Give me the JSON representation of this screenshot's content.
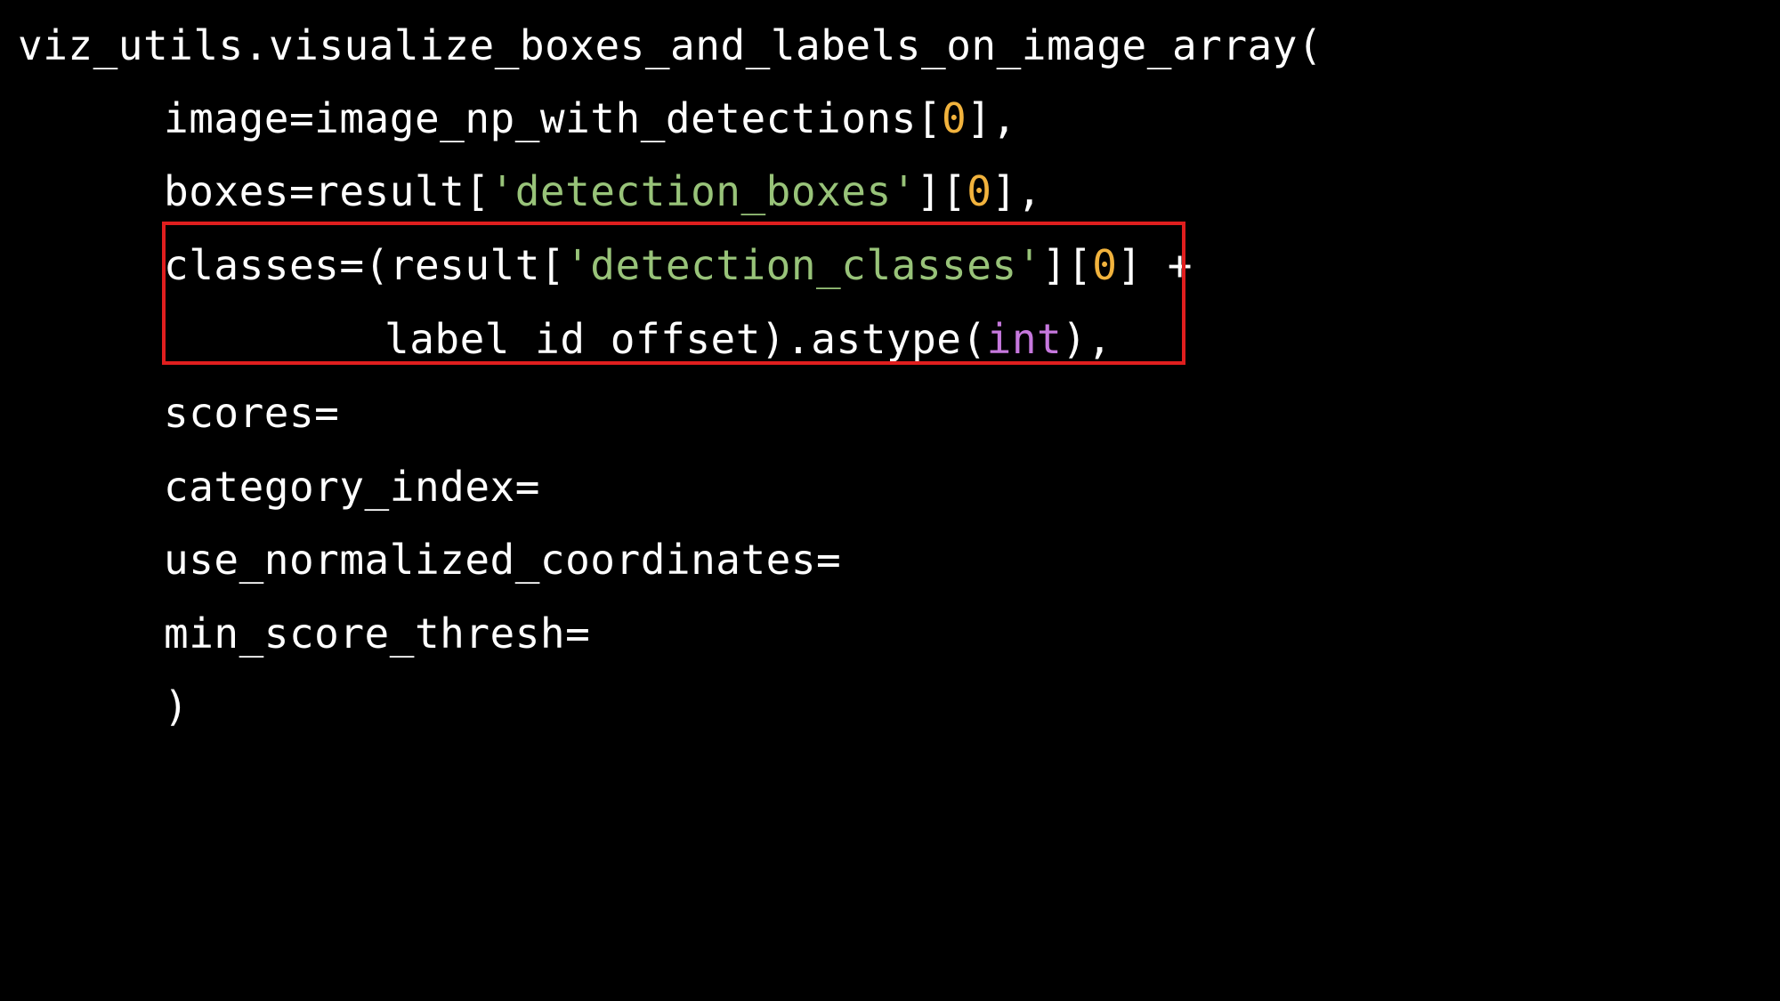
{
  "colors": {
    "background": "#000000",
    "text": "#ffffff",
    "string": "#98c379",
    "number": "#f2b33d",
    "keyword": "#c678dd",
    "highlight_border": "#e01e1e"
  },
  "code": {
    "line1": {
      "text": "viz_utils.visualize_boxes_and_labels_on_image_array("
    },
    "line2": {
      "pre": "image=image_np_with_detections[",
      "num": "0",
      "post": "],"
    },
    "line3": {
      "pre": "boxes=result[",
      "str": "'detection_boxes'",
      "mid": "][",
      "num": "0",
      "post": "],"
    },
    "line4": {
      "pre": "classes=(result[",
      "str": "'detection_classes'",
      "mid": "][",
      "num": "0",
      "post": "] +"
    },
    "line5": {
      "pre": "label_id_offset).astype(",
      "kw": "int",
      "post": "),"
    },
    "line6": {
      "text": "scores="
    },
    "line7": {
      "text": "category_index="
    },
    "line8": {
      "text": "use_normalized_coordinates="
    },
    "line9": {
      "text": "min_score_thresh="
    },
    "line10": {
      "text": ")"
    }
  }
}
